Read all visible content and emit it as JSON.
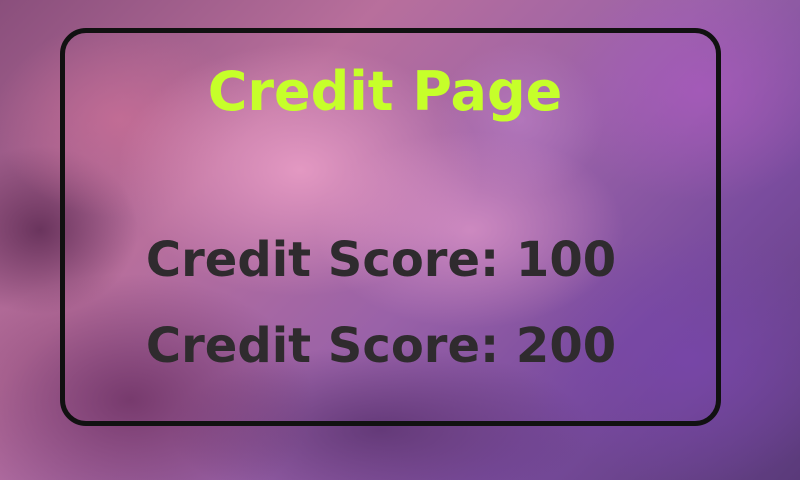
{
  "page": {
    "title": "Credit Page",
    "title_color": "#c6ff2a",
    "text_color": "#2f2b2e",
    "border_color": "#111111"
  },
  "scores": [
    {
      "text": "Credit Score: 100"
    },
    {
      "text": "Credit Score: 200"
    }
  ]
}
